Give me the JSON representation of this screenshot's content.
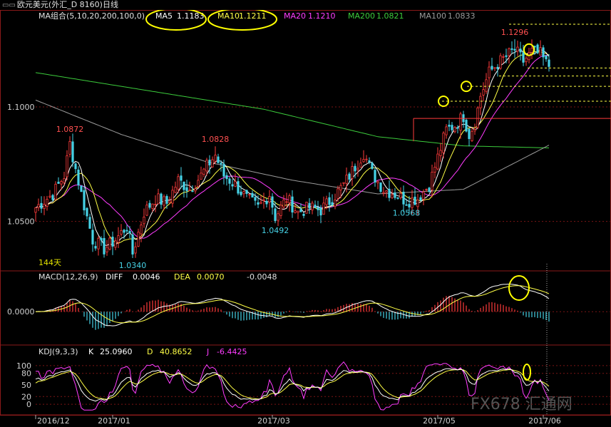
{
  "window": {
    "icon": "window-restore-icon",
    "title": "欧元美元(外汇_D 8160)日线"
  },
  "colors": {
    "background": "#000000",
    "up_candle": "#ff3b3b",
    "down_candle": "#46d2e6",
    "ma5": "#ffffff",
    "ma10": "#ffff46",
    "ma20": "#ff3cff",
    "ma200": "#3ccc3c",
    "ma100": "#9a9a9a",
    "grid": "#7a1414",
    "axis_text": "#ff4040",
    "highlight": "#ffff00"
  },
  "chart_data": [
    {
      "type": "candlestick",
      "panel": "price",
      "legend": {
        "label": "MA组合(5,10,20,200,100,0)",
        "items": [
          {
            "name": "MA5",
            "value": "1.1183"
          },
          {
            "name": "MA10",
            "value": "1.1211"
          },
          {
            "name": "MA20",
            "value": "1.1210"
          },
          {
            "name": "MA200",
            "value": "1.0821"
          },
          {
            "name": "MA100",
            "value": "1.0833"
          }
        ]
      },
      "y_ticks": [
        "1.1000",
        "1.0500"
      ],
      "ylim": [
        1.029,
        1.138
      ],
      "x_ticks": [
        "2016/12",
        "2017/01",
        "2017/03",
        "2017/05",
        "2017/06"
      ],
      "x_tick_indices": [
        0,
        27,
        83,
        141,
        178
      ],
      "annotations": [
        {
          "text": "1.0872",
          "index": 12,
          "value": 1.0872,
          "kind": "high"
        },
        {
          "text": "1.0828",
          "index": 63,
          "value": 1.0828,
          "kind": "high"
        },
        {
          "text": "1.1296",
          "index": 168,
          "value": 1.1296,
          "kind": "high"
        },
        {
          "text": "1.0340",
          "index": 34,
          "value": 1.034,
          "kind": "low"
        },
        {
          "text": "1.0492",
          "index": 84,
          "value": 1.0492,
          "kind": "low"
        },
        {
          "text": "1.0568",
          "index": 130,
          "value": 1.0568,
          "kind": "low"
        }
      ],
      "period_label": "144天",
      "anchors": [
        [
          0,
          1.056
        ],
        [
          6,
          1.062
        ],
        [
          10,
          1.07
        ],
        [
          12,
          1.084
        ],
        [
          16,
          1.062
        ],
        [
          20,
          1.042
        ],
        [
          24,
          1.038
        ],
        [
          28,
          1.042
        ],
        [
          32,
          1.048
        ],
        [
          34,
          1.036
        ],
        [
          38,
          1.054
        ],
        [
          42,
          1.06
        ],
        [
          46,
          1.058
        ],
        [
          50,
          1.068
        ],
        [
          54,
          1.064
        ],
        [
          58,
          1.07
        ],
        [
          60,
          1.074
        ],
        [
          63,
          1.079
        ],
        [
          66,
          1.07
        ],
        [
          70,
          1.066
        ],
        [
          74,
          1.06
        ],
        [
          78,
          1.056
        ],
        [
          82,
          1.062
        ],
        [
          84,
          1.052
        ],
        [
          88,
          1.06
        ],
        [
          92,
          1.054
        ],
        [
          96,
          1.056
        ],
        [
          100,
          1.055
        ],
        [
          104,
          1.06
        ],
        [
          108,
          1.066
        ],
        [
          112,
          1.074
        ],
        [
          115,
          1.08
        ],
        [
          118,
          1.071
        ],
        [
          122,
          1.064
        ],
        [
          126,
          1.062
        ],
        [
          130,
          1.059
        ],
        [
          134,
          1.06
        ],
        [
          138,
          1.066
        ],
        [
          141,
          1.078
        ],
        [
          144,
          1.09
        ],
        [
          147,
          1.092
        ],
        [
          150,
          1.096
        ],
        [
          152,
          1.088
        ],
        [
          154,
          1.093
        ],
        [
          156,
          1.105
        ],
        [
          159,
          1.115
        ],
        [
          162,
          1.119
        ],
        [
          165,
          1.122
        ],
        [
          168,
          1.125
        ],
        [
          171,
          1.12
        ],
        [
          174,
          1.124
        ],
        [
          177,
          1.123
        ],
        [
          179,
          1.119
        ],
        [
          180,
          1.118
        ]
      ],
      "ma_anchors": {
        "MA200": [
          [
            0,
            1.115
          ],
          [
            40,
            1.107
          ],
          [
            80,
            1.099
          ],
          [
            120,
            1.087
          ],
          [
            150,
            1.083
          ],
          [
            180,
            1.0821
          ]
        ],
        "MA100": [
          [
            0,
            1.103
          ],
          [
            30,
            1.088
          ],
          [
            60,
            1.076
          ],
          [
            90,
            1.068
          ],
          [
            120,
            1.062
          ],
          [
            150,
            1.064
          ],
          [
            180,
            1.0833
          ]
        ]
      }
    },
    {
      "type": "macd",
      "panel": "macd",
      "legend": {
        "label": "MACD(12,26,9)",
        "items": [
          {
            "name": "DIFF",
            "value": "0.0046"
          },
          {
            "name": "DEA",
            "value": "0.0070"
          },
          {
            "name": "",
            "value": "-0.0048"
          }
        ]
      },
      "y_ticks": [
        "0.0000"
      ],
      "ylim": [
        -0.012,
        0.014
      ]
    },
    {
      "type": "kdj",
      "panel": "kdj",
      "legend": {
        "label": "KDJ(9,3,3)",
        "items": [
          {
            "name": "K",
            "value": "25.0960"
          },
          {
            "name": "D",
            "value": "40.8652"
          },
          {
            "name": "J",
            "value": "-6.4425"
          }
        ]
      },
      "y_ticks": [
        "100",
        "80",
        "50",
        "20",
        "0"
      ],
      "ylim": [
        -20,
        120
      ]
    }
  ],
  "watermark": {
    "text": "FX678 汇通网"
  }
}
